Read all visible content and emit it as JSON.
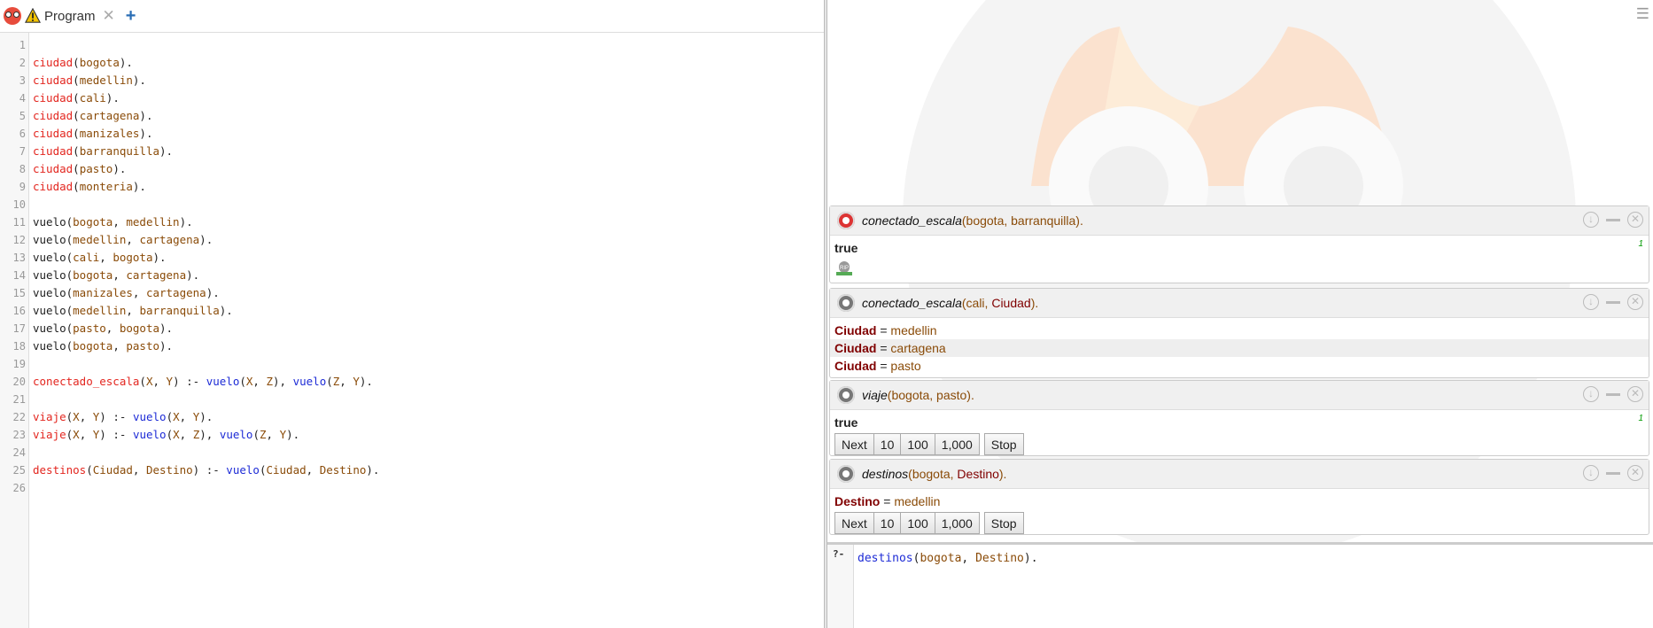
{
  "editor": {
    "tab_title": "Program",
    "tab_close": "✕",
    "add_tab": "+",
    "lines": [
      {
        "n": "1",
        "tokens": []
      },
      {
        "n": "2",
        "tokens": [
          [
            "kw",
            "ciudad"
          ],
          [
            "pn",
            "("
          ],
          [
            "at",
            "bogota"
          ],
          [
            "pn",
            ")."
          ]
        ]
      },
      {
        "n": "3",
        "tokens": [
          [
            "kw",
            "ciudad"
          ],
          [
            "pn",
            "("
          ],
          [
            "at",
            "medellin"
          ],
          [
            "pn",
            ")."
          ]
        ]
      },
      {
        "n": "4",
        "tokens": [
          [
            "kw",
            "ciudad"
          ],
          [
            "pn",
            "("
          ],
          [
            "at",
            "cali"
          ],
          [
            "pn",
            ")."
          ]
        ]
      },
      {
        "n": "5",
        "tokens": [
          [
            "kw",
            "ciudad"
          ],
          [
            "pn",
            "("
          ],
          [
            "at",
            "cartagena"
          ],
          [
            "pn",
            ")."
          ]
        ]
      },
      {
        "n": "6",
        "tokens": [
          [
            "kw",
            "ciudad"
          ],
          [
            "pn",
            "("
          ],
          [
            "at",
            "manizales"
          ],
          [
            "pn",
            ")."
          ]
        ]
      },
      {
        "n": "7",
        "tokens": [
          [
            "kw",
            "ciudad"
          ],
          [
            "pn",
            "("
          ],
          [
            "at",
            "barranquilla"
          ],
          [
            "pn",
            ")."
          ]
        ]
      },
      {
        "n": "8",
        "tokens": [
          [
            "kw",
            "ciudad"
          ],
          [
            "pn",
            "("
          ],
          [
            "at",
            "pasto"
          ],
          [
            "pn",
            ")."
          ]
        ]
      },
      {
        "n": "9",
        "tokens": [
          [
            "kw",
            "ciudad"
          ],
          [
            "pn",
            "("
          ],
          [
            "at",
            "monteria"
          ],
          [
            "pn",
            ")."
          ]
        ]
      },
      {
        "n": "10",
        "tokens": []
      },
      {
        "n": "11",
        "tokens": [
          [
            "pn",
            "vuelo("
          ],
          [
            "at",
            "bogota"
          ],
          [
            "pn",
            ", "
          ],
          [
            "at",
            "medellin"
          ],
          [
            "pn",
            ")."
          ]
        ]
      },
      {
        "n": "12",
        "tokens": [
          [
            "pn",
            "vuelo("
          ],
          [
            "at",
            "medellin"
          ],
          [
            "pn",
            ", "
          ],
          [
            "at",
            "cartagena"
          ],
          [
            "pn",
            ")."
          ]
        ]
      },
      {
        "n": "13",
        "tokens": [
          [
            "pn",
            "vuelo("
          ],
          [
            "at",
            "cali"
          ],
          [
            "pn",
            ", "
          ],
          [
            "at",
            "bogota"
          ],
          [
            "pn",
            ")."
          ]
        ]
      },
      {
        "n": "14",
        "tokens": [
          [
            "pn",
            "vuelo("
          ],
          [
            "at",
            "bogota"
          ],
          [
            "pn",
            ", "
          ],
          [
            "at",
            "cartagena"
          ],
          [
            "pn",
            ")."
          ]
        ]
      },
      {
        "n": "15",
        "tokens": [
          [
            "pn",
            "vuelo("
          ],
          [
            "at",
            "manizales"
          ],
          [
            "pn",
            ", "
          ],
          [
            "at",
            "cartagena"
          ],
          [
            "pn",
            ")."
          ]
        ]
      },
      {
        "n": "16",
        "tokens": [
          [
            "pn",
            "vuelo("
          ],
          [
            "at",
            "medellin"
          ],
          [
            "pn",
            ", "
          ],
          [
            "at",
            "barranquilla"
          ],
          [
            "pn",
            ")."
          ]
        ]
      },
      {
        "n": "17",
        "tokens": [
          [
            "pn",
            "vuelo("
          ],
          [
            "at",
            "pasto"
          ],
          [
            "pn",
            ", "
          ],
          [
            "at",
            "bogota"
          ],
          [
            "pn",
            ")."
          ]
        ]
      },
      {
        "n": "18",
        "tokens": [
          [
            "pn",
            "vuelo("
          ],
          [
            "at",
            "bogota"
          ],
          [
            "pn",
            ", "
          ],
          [
            "at",
            "pasto"
          ],
          [
            "pn",
            ")."
          ]
        ]
      },
      {
        "n": "19",
        "tokens": []
      },
      {
        "n": "20",
        "tokens": [
          [
            "kw",
            "conectado_escala"
          ],
          [
            "pn",
            "("
          ],
          [
            "vr",
            "X"
          ],
          [
            "pn",
            ", "
          ],
          [
            "vr",
            "Y"
          ],
          [
            "pn",
            ") :- "
          ],
          [
            "bi",
            "vuelo"
          ],
          [
            "pn",
            "("
          ],
          [
            "vr",
            "X"
          ],
          [
            "pn",
            ", "
          ],
          [
            "vr",
            "Z"
          ],
          [
            "pn",
            "), "
          ],
          [
            "bi",
            "vuelo"
          ],
          [
            "pn",
            "("
          ],
          [
            "vr",
            "Z"
          ],
          [
            "pn",
            ", "
          ],
          [
            "vr",
            "Y"
          ],
          [
            "pn",
            ")."
          ]
        ]
      },
      {
        "n": "21",
        "tokens": []
      },
      {
        "n": "22",
        "tokens": [
          [
            "kw",
            "viaje"
          ],
          [
            "pn",
            "("
          ],
          [
            "vr",
            "X"
          ],
          [
            "pn",
            ", "
          ],
          [
            "vr",
            "Y"
          ],
          [
            "pn",
            ") :- "
          ],
          [
            "bi",
            "vuelo"
          ],
          [
            "pn",
            "("
          ],
          [
            "vr",
            "X"
          ],
          [
            "pn",
            ", "
          ],
          [
            "vr",
            "Y"
          ],
          [
            "pn",
            ")."
          ]
        ]
      },
      {
        "n": "23",
        "tokens": [
          [
            "kw",
            "viaje"
          ],
          [
            "pn",
            "("
          ],
          [
            "vr",
            "X"
          ],
          [
            "pn",
            ", "
          ],
          [
            "vr",
            "Y"
          ],
          [
            "pn",
            ") :- "
          ],
          [
            "bi",
            "vuelo"
          ],
          [
            "pn",
            "("
          ],
          [
            "vr",
            "X"
          ],
          [
            "pn",
            ", "
          ],
          [
            "vr",
            "Z"
          ],
          [
            "pn",
            "), "
          ],
          [
            "bi",
            "vuelo"
          ],
          [
            "pn",
            "("
          ],
          [
            "vr",
            "Z"
          ],
          [
            "pn",
            ", "
          ],
          [
            "vr",
            "Y"
          ],
          [
            "pn",
            ")."
          ]
        ]
      },
      {
        "n": "24",
        "tokens": []
      },
      {
        "n": "25",
        "tokens": [
          [
            "kw",
            "destinos"
          ],
          [
            "pn",
            "("
          ],
          [
            "vr",
            "Ciudad"
          ],
          [
            "pn",
            ", "
          ],
          [
            "vr",
            "Destino"
          ],
          [
            "pn",
            ") :- "
          ],
          [
            "bi",
            "vuelo"
          ],
          [
            "pn",
            "("
          ],
          [
            "vr",
            "Ciudad"
          ],
          [
            "pn",
            ", "
          ],
          [
            "vr",
            "Destino"
          ],
          [
            "pn",
            ")."
          ]
        ]
      },
      {
        "n": "26",
        "tokens": []
      }
    ]
  },
  "answers": [
    {
      "query_pred": "conectado_escala",
      "query_args": "(bogota, barranquilla).",
      "gear_color": "red",
      "result": "true",
      "count": "1"
    },
    {
      "query_pred": "conectado_escala",
      "query_args_pre": "(cali, ",
      "query_var": "Ciudad",
      "query_args_post": ").",
      "bindings": [
        {
          "var": "Ciudad",
          "eq": " = ",
          "val": "medellin"
        },
        {
          "var": "Ciudad",
          "eq": " = ",
          "val": "cartagena"
        },
        {
          "var": "Ciudad",
          "eq": " = ",
          "val": "pasto"
        }
      ]
    },
    {
      "query_pred": "viaje",
      "query_args": "(bogota, pasto).",
      "result": "true",
      "count": "1",
      "buttons": [
        "Next",
        "10",
        "100",
        "1,000"
      ],
      "stop": "Stop"
    },
    {
      "query_pred": "destinos",
      "query_args_pre": "(bogota, ",
      "query_var": "Destino",
      "query_args_post": ").",
      "binding": {
        "var": "Destino",
        "eq": " = ",
        "val": "medellin"
      },
      "buttons": [
        "Next",
        "10",
        "100",
        "1,000"
      ],
      "stop": "Stop"
    }
  ],
  "query": {
    "prompt": "?-",
    "pred": "destinos",
    "open": "(",
    "arg1": "bogota",
    "sep": ", ",
    "arg2": "Destino",
    "close": ")."
  },
  "icons": {
    "menu": "☰",
    "download": "↓",
    "close": "✕"
  },
  "colors": {
    "keyword": "#e3261f",
    "builtin": "#1d2bd6",
    "atom": "#8a4b08",
    "binding_var": "#800000"
  }
}
